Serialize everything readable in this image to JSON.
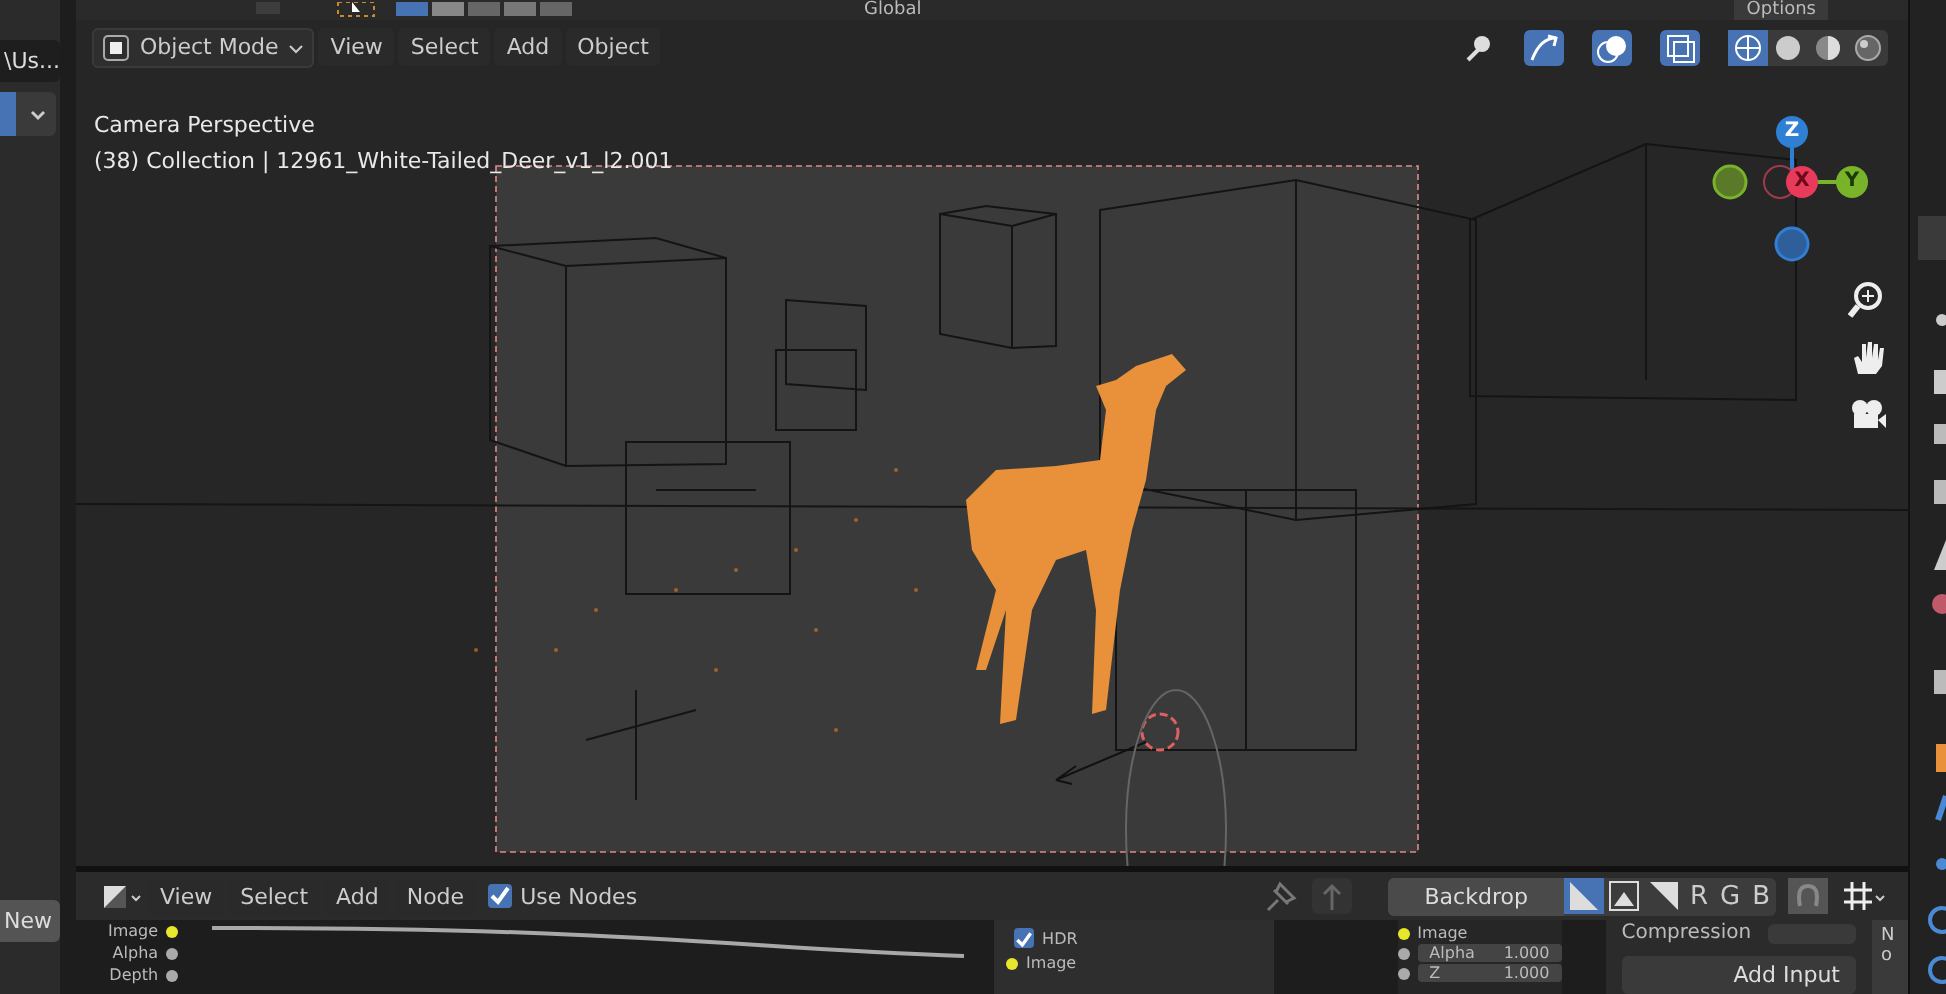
{
  "top_toolbar": {
    "orientation": "Global",
    "options": "Options"
  },
  "left_panel": {
    "path_field": "\\Us...",
    "new_button": "New"
  },
  "viewport": {
    "mode": "Object Mode",
    "menus": [
      "View",
      "Select",
      "Add",
      "Object"
    ],
    "overlay_title": "Camera Perspective",
    "overlay_info": "(38) Collection | 12961_White-Tailed_Deer_v1_l2.001",
    "shading": [
      {
        "kind": "wire",
        "selected": true
      },
      {
        "kind": "solid",
        "selected": false
      },
      {
        "kind": "material",
        "selected": false
      },
      {
        "kind": "rendered",
        "selected": false
      }
    ],
    "gizmo": {
      "z": "Z",
      "x": "X",
      "y": "Y"
    }
  },
  "node_editor": {
    "menus": [
      "View",
      "Select",
      "Add",
      "Node"
    ],
    "use_nodes": {
      "label": "Use Nodes",
      "checked": true
    },
    "backdrop": "Backdrop",
    "backdrop_modes": [
      {
        "kind": "color",
        "selected": true
      },
      {
        "kind": "alpha",
        "selected": false
      },
      {
        "kind": "both",
        "selected": false
      }
    ],
    "channels": [
      "R",
      "G",
      "B"
    ],
    "render_outputs": [
      "Image",
      "Alpha",
      "Depth"
    ],
    "middle_node": {
      "hdr": {
        "label": "HDR",
        "checked": true
      },
      "socket": "Image"
    },
    "output_node": [
      {
        "label": "Image"
      },
      {
        "label": "Alpha",
        "value": "1.000"
      },
      {
        "label": "Z",
        "value": "1.000"
      }
    ],
    "sidebar": {
      "field_label": "Compression",
      "add_input": "Add Input",
      "tab": "No"
    }
  }
}
